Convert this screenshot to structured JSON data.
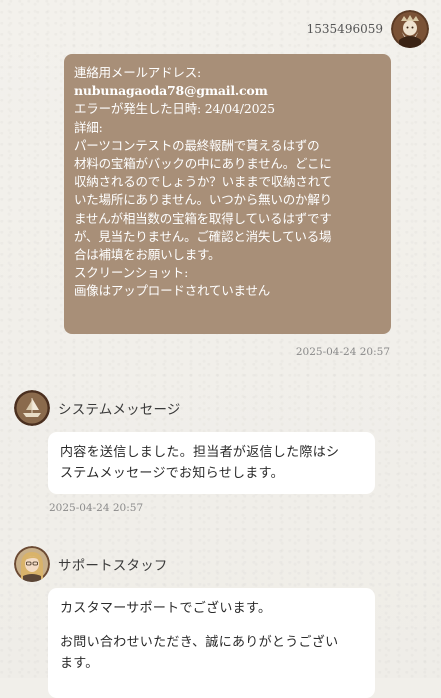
{
  "user_message": {
    "sender": "1535496059",
    "lines": [
      {
        "text": "連絡用メールアドレス:",
        "bold": false
      },
      {
        "text": "nubunagaoda78@gmail.com",
        "bold": true
      },
      {
        "text": "エラーが発生した日時: 24/04/2025",
        "bold": false
      },
      {
        "text": "詳細:",
        "bold": false
      },
      {
        "text": "パーツコンテストの最終報酬で貰えるはずの",
        "bold": false
      },
      {
        "text": "材料の宝箱がバックの中にありません。どこに",
        "bold": false
      },
      {
        "text": "収納されるのでしょうか？いままで収納されて",
        "bold": false
      },
      {
        "text": "いた場所にありません。いつから無いのか解り",
        "bold": false
      },
      {
        "text": "ませんが相当数の宝箱を取得しているはずです",
        "bold": false
      },
      {
        "text": "が、見当たりません。ご確認と消失している場",
        "bold": false
      },
      {
        "text": "合は補填をお願いします。",
        "bold": false
      },
      {
        "text": "スクリーンショット:",
        "bold": false
      },
      {
        "text": "画像はアップロードされていません",
        "bold": false
      }
    ],
    "timestamp": "2025-04-24 20:57"
  },
  "system_message": {
    "sender": "システムメッセージ",
    "lines": [
      "内容を送信しました。担当者が返信した際はシ",
      "ステムメッセージでお知らせします。"
    ],
    "timestamp": "2025-04-24 20:57"
  },
  "support_message": {
    "sender": "サポートスタッフ",
    "paragraph1": "カスタマーサポートでございます。",
    "paragraph2_lines": [
      "お問い合わせいただき、誠にありがとうござい",
      "ます。"
    ]
  },
  "colors": {
    "background": "#f1efea",
    "user_bubble": "#a88f78",
    "white_bubble": "#ffffff",
    "timestamp": "#8a8a8a"
  },
  "icons": {
    "user_avatar": "bearded-king-avatar-icon",
    "system_avatar": "ship-emblem-avatar-icon",
    "support_avatar": "blonde-staff-avatar-icon"
  }
}
